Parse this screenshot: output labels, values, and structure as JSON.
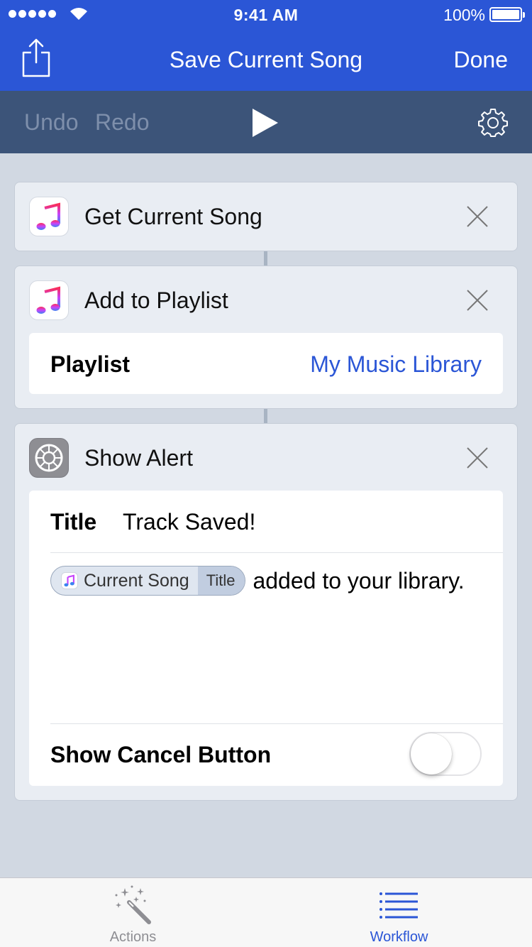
{
  "status_bar": {
    "time": "9:41 AM",
    "battery": "100%"
  },
  "nav": {
    "title": "Save Current Song",
    "done_label": "Done",
    "share_icon": "share-icon"
  },
  "toolbar": {
    "undo_label": "Undo",
    "redo_label": "Redo",
    "play_icon": "play-icon",
    "settings_icon": "gear-icon"
  },
  "actions": [
    {
      "title": "Get Current Song",
      "icon": "music-icon"
    },
    {
      "title": "Add to Playlist",
      "icon": "music-icon",
      "playlist_label": "Playlist",
      "playlist_value": "My Music Library"
    },
    {
      "title": "Show Alert",
      "icon": "settings-icon",
      "title_label": "Title",
      "title_value": "Track Saved!",
      "message_token": {
        "name": "Current Song",
        "property": "Title"
      },
      "message_text": "added to your library.",
      "cancel_label": "Show Cancel Button",
      "cancel_enabled": false
    }
  ],
  "tabs": [
    {
      "label": "Actions",
      "icon": "magic-wand-icon",
      "active": false
    },
    {
      "label": "Workflow",
      "icon": "list-icon",
      "active": true
    }
  ],
  "colors": {
    "accent": "#2b56d6",
    "toolbar": "#3c5479",
    "background": "#d1d8e2"
  }
}
